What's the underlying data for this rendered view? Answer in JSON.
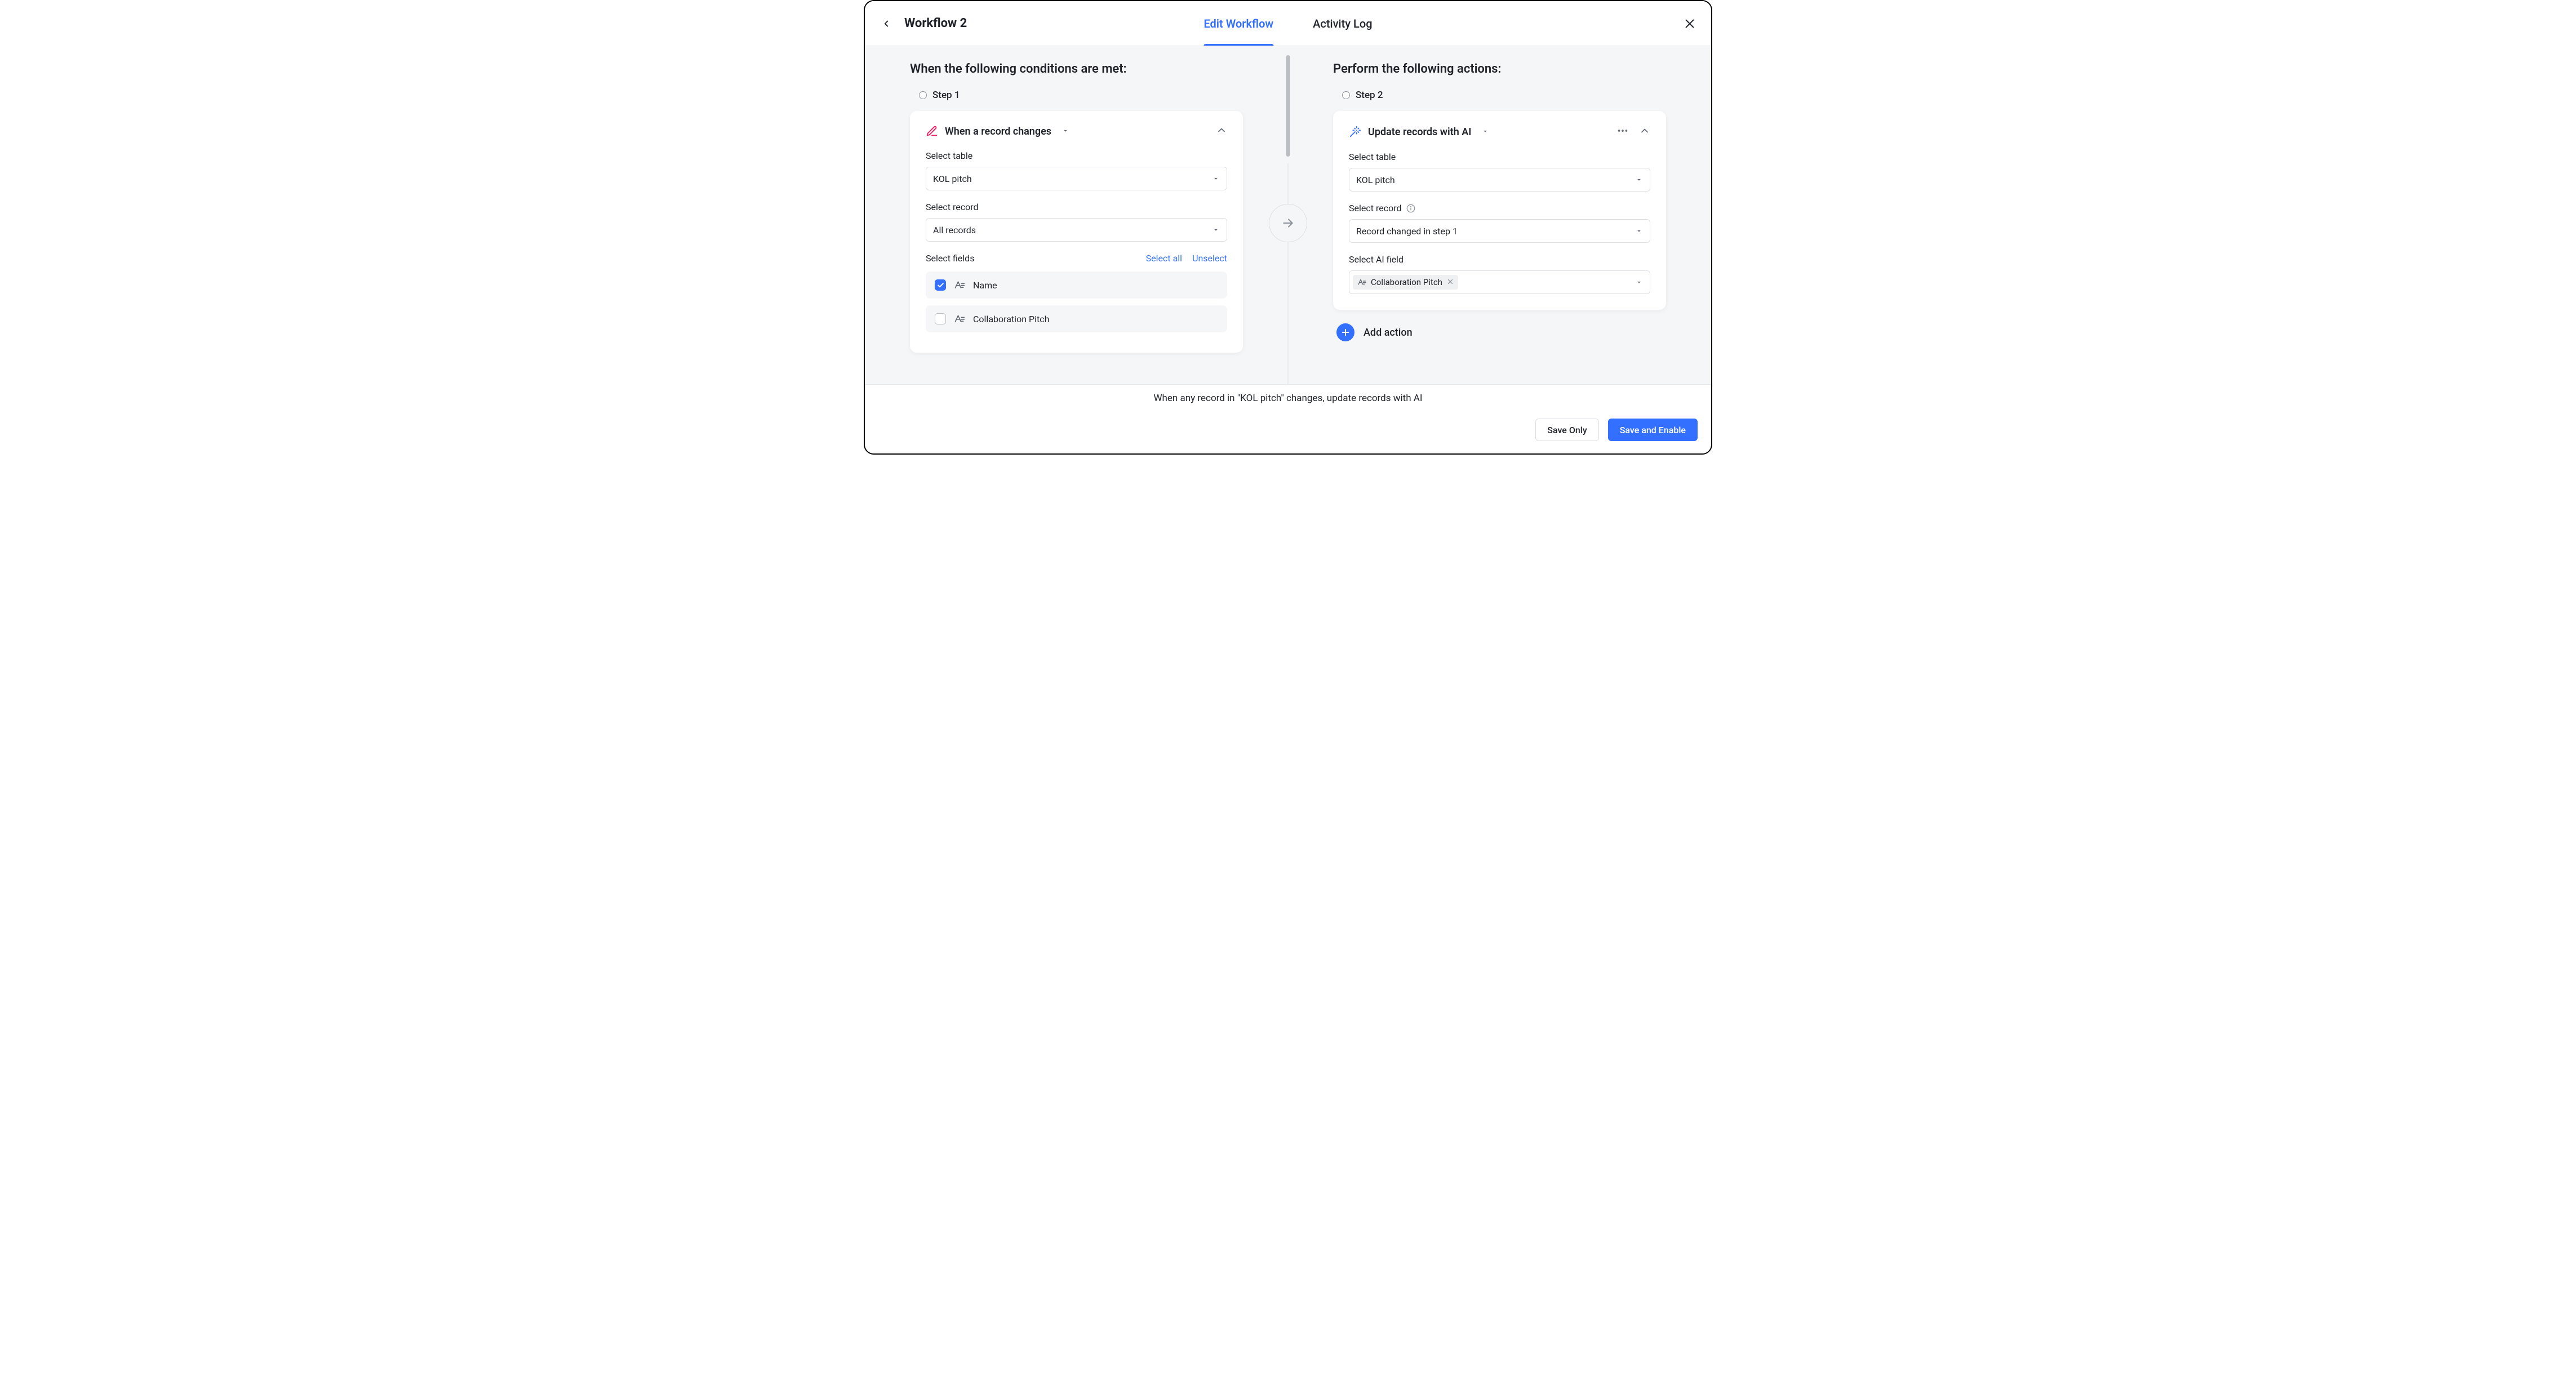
{
  "header": {
    "title": "Workflow 2",
    "tabs": {
      "edit": "Edit Workflow",
      "activity": "Activity Log"
    }
  },
  "conditions": {
    "heading": "When the following conditions are met:",
    "step_label": "Step 1",
    "trigger_title": "When a record changes",
    "select_table_label": "Select table",
    "select_table_value": "KOL pitch",
    "select_record_label": "Select record",
    "select_record_value": "All records",
    "select_fields_label": "Select fields",
    "select_all_label": "Select all",
    "unselect_label": "Unselect",
    "fields": [
      {
        "name": "Name",
        "checked": true
      },
      {
        "name": "Collaboration Pitch",
        "checked": false
      }
    ]
  },
  "actions": {
    "heading": "Perform the following actions:",
    "step_label": "Step 2",
    "action_title": "Update records with AI",
    "select_table_label": "Select table",
    "select_table_value": "KOL pitch",
    "select_record_label": "Select record",
    "select_record_value": "Record changed in step 1",
    "select_ai_field_label": "Select AI field",
    "ai_field_chip": "Collaboration Pitch",
    "add_action_label": "Add action"
  },
  "footer": {
    "summary": "When any record in \"KOL pitch\" changes, update records with AI",
    "save_only": "Save Only",
    "save_enable": "Save and Enable"
  }
}
